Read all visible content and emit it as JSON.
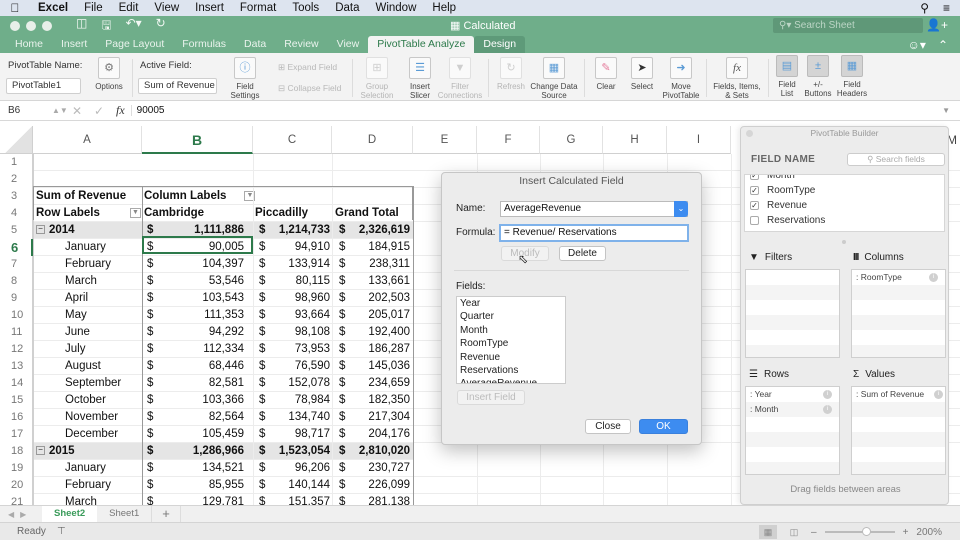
{
  "menubar": {
    "app": "Excel",
    "items": [
      "File",
      "Edit",
      "View",
      "Insert",
      "Format",
      "Tools",
      "Data",
      "Window",
      "Help"
    ]
  },
  "window": {
    "title": "Calculated",
    "search_placeholder": "Search Sheet"
  },
  "ribbon_tabs": [
    "Home",
    "Insert",
    "Page Layout",
    "Formulas",
    "Data",
    "Review",
    "View",
    "PivotTable Analyze",
    "Design"
  ],
  "active_ribbon_tab": "PivotTable Analyze",
  "ribbon": {
    "pivot_name_label": "PivotTable Name:",
    "pivot_name_value": "PivotTable1",
    "options_label": "Options",
    "active_field_label": "Active Field:",
    "active_field_value": "Sum of Revenue",
    "field_settings_label": "Field Settings",
    "expand_field": "Expand Field",
    "collapse_field": "Collapse Field",
    "group_selection": "Group Selection",
    "insert_slicer": "Insert Slicer",
    "filter_connections": "Filter Connections",
    "refresh": "Refresh",
    "change_data_source": "Change Data Source",
    "clear": "Clear",
    "select": "Select",
    "move_pivottable": "Move PivotTable",
    "fields_items_sets": "Fields, Items, & Sets",
    "field_list": "Field List",
    "plus_minus_buttons": "+/- Buttons",
    "field_headers": "Field Headers"
  },
  "formula_bar": {
    "name_box": "B6",
    "value": "90005"
  },
  "columns": [
    "A",
    "B",
    "C",
    "D",
    "E",
    "F",
    "G",
    "H",
    "I",
    "M"
  ],
  "selected_column": "B",
  "selected_row": "6",
  "pivot": {
    "header_value_label": "Sum of Revenue",
    "column_labels": "Column Labels",
    "row_labels": "Row Labels",
    "col_headers": [
      "Cambridge",
      "Piccadilly",
      "Grand Total"
    ],
    "currency": "$",
    "rows": [
      {
        "row": "5",
        "label": "2014",
        "type": "year",
        "values": [
          "1,111,886",
          "1,214,733",
          "2,326,619"
        ]
      },
      {
        "row": "6",
        "label": "January",
        "type": "month",
        "values": [
          "90,005",
          "94,910",
          "184,915"
        ]
      },
      {
        "row": "7",
        "label": "February",
        "type": "month",
        "values": [
          "104,397",
          "133,914",
          "238,311"
        ]
      },
      {
        "row": "8",
        "label": "March",
        "type": "month",
        "values": [
          "53,546",
          "80,115",
          "133,661"
        ]
      },
      {
        "row": "9",
        "label": "April",
        "type": "month",
        "values": [
          "103,543",
          "98,960",
          "202,503"
        ]
      },
      {
        "row": "10",
        "label": "May",
        "type": "month",
        "values": [
          "111,353",
          "93,664",
          "205,017"
        ]
      },
      {
        "row": "11",
        "label": "June",
        "type": "month",
        "values": [
          "94,292",
          "98,108",
          "192,400"
        ]
      },
      {
        "row": "12",
        "label": "July",
        "type": "month",
        "values": [
          "112,334",
          "73,953",
          "186,287"
        ]
      },
      {
        "row": "13",
        "label": "August",
        "type": "month",
        "values": [
          "68,446",
          "76,590",
          "145,036"
        ]
      },
      {
        "row": "14",
        "label": "September",
        "type": "month",
        "values": [
          "82,581",
          "152,078",
          "234,659"
        ]
      },
      {
        "row": "15",
        "label": "October",
        "type": "month",
        "values": [
          "103,366",
          "78,984",
          "182,350"
        ]
      },
      {
        "row": "16",
        "label": "November",
        "type": "month",
        "values": [
          "82,564",
          "134,740",
          "217,304"
        ]
      },
      {
        "row": "17",
        "label": "December",
        "type": "month",
        "values": [
          "105,459",
          "98,717",
          "204,176"
        ]
      },
      {
        "row": "18",
        "label": "2015",
        "type": "year",
        "values": [
          "1,286,966",
          "1,523,054",
          "2,810,020"
        ]
      },
      {
        "row": "19",
        "label": "January",
        "type": "month",
        "values": [
          "134,521",
          "96,206",
          "230,727"
        ]
      },
      {
        "row": "20",
        "label": "February",
        "type": "month",
        "values": [
          "85,955",
          "140,144",
          "226,099"
        ]
      },
      {
        "row": "21",
        "label": "March",
        "type": "month",
        "values": [
          "129,781",
          "151,357",
          "281,138"
        ]
      }
    ]
  },
  "dialog": {
    "title": "Insert Calculated Field",
    "name_label": "Name:",
    "name_value": "AverageRevenue",
    "formula_label": "Formula:",
    "formula_value": "= Revenue/ Reservations",
    "modify": "Modify",
    "delete": "Delete",
    "fields_label": "Fields:",
    "fields": [
      "Year",
      "Quarter",
      "Month",
      "RoomType",
      "Revenue",
      "Reservations",
      "AverageRevenue"
    ],
    "insert_field": "Insert Field",
    "close": "Close",
    "ok": "OK"
  },
  "builder": {
    "title": "PivotTable Builder",
    "field_name_header": "FIELD NAME",
    "search_placeholder": "Search fields",
    "fields": [
      {
        "name": "Month",
        "checked": true
      },
      {
        "name": "RoomType",
        "checked": true
      },
      {
        "name": "Revenue",
        "checked": true
      },
      {
        "name": "Reservations",
        "checked": false
      }
    ],
    "filters_label": "Filters",
    "columns_label": "Columns",
    "rows_label": "Rows",
    "values_label": "Values",
    "filters": [],
    "columns": [
      "RoomType"
    ],
    "rows": [
      "Year",
      "Month"
    ],
    "values": [
      "Sum of Revenue"
    ],
    "footer": "Drag fields between areas"
  },
  "sheet_tabs": [
    "Sheet2",
    "Sheet1"
  ],
  "active_sheet": "Sheet2",
  "status": {
    "text": "Ready",
    "zoom": "200%",
    "zoom_level_fraction": 0.6
  }
}
